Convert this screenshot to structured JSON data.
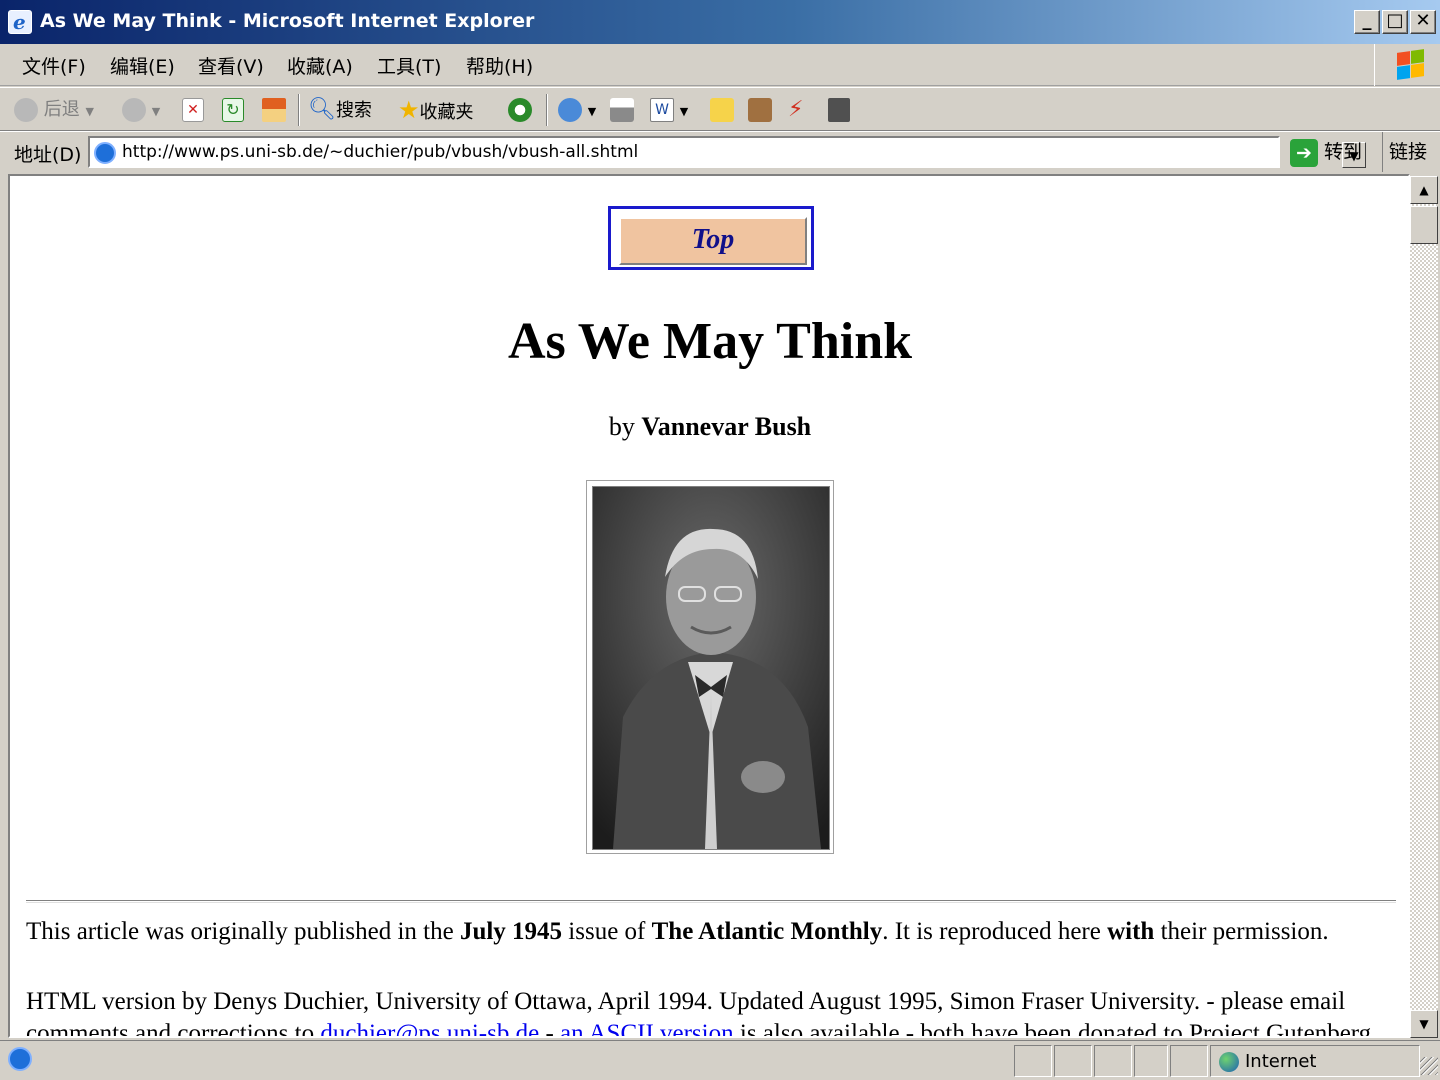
{
  "window": {
    "title": "As We May Think - Microsoft Internet Explorer"
  },
  "menubar": {
    "items": [
      "文件(F)",
      "编辑(E)",
      "查看(V)",
      "收藏(A)",
      "工具(T)",
      "帮助(H)"
    ]
  },
  "toolbar": {
    "back": "后退",
    "search": "搜索",
    "favorites": "收藏夹"
  },
  "address": {
    "label": "地址(D)",
    "url": "http://www.ps.uni-sb.de/~duchier/pub/vbush/vbush-all.shtml",
    "go": "转到",
    "links": "链接"
  },
  "page": {
    "top_button": "Top",
    "heading": "As We May Think",
    "byline_prefix": "by",
    "author": "Vannevar Bush",
    "p1": {
      "t1": "This article was originally published in the ",
      "b1": "July 1945",
      "t2": " issue of ",
      "b2": "The Atlantic Monthly",
      "t3": ". It is reproduced here ",
      "b3": "with",
      "t4": " their permission."
    },
    "p2": {
      "t1": "HTML version by Denys Duchier, University of Ottawa, April 1994. Updated August 1995, Simon Fraser University. - please email comments and corrections to ",
      "email": "duchier@ps.uni-sb.de",
      "t2": " - ",
      "ascii": "an ASCII version",
      "t3": " is also available - both have been donated to Project Gutenberg"
    }
  },
  "status": {
    "zone": "Internet"
  },
  "colors": {
    "title_start": "#0a246a",
    "title_end": "#a6caf0",
    "link": "#0000ee",
    "top_btn_bg": "#f0c4a0",
    "top_btn_border": "#1a1acc"
  }
}
